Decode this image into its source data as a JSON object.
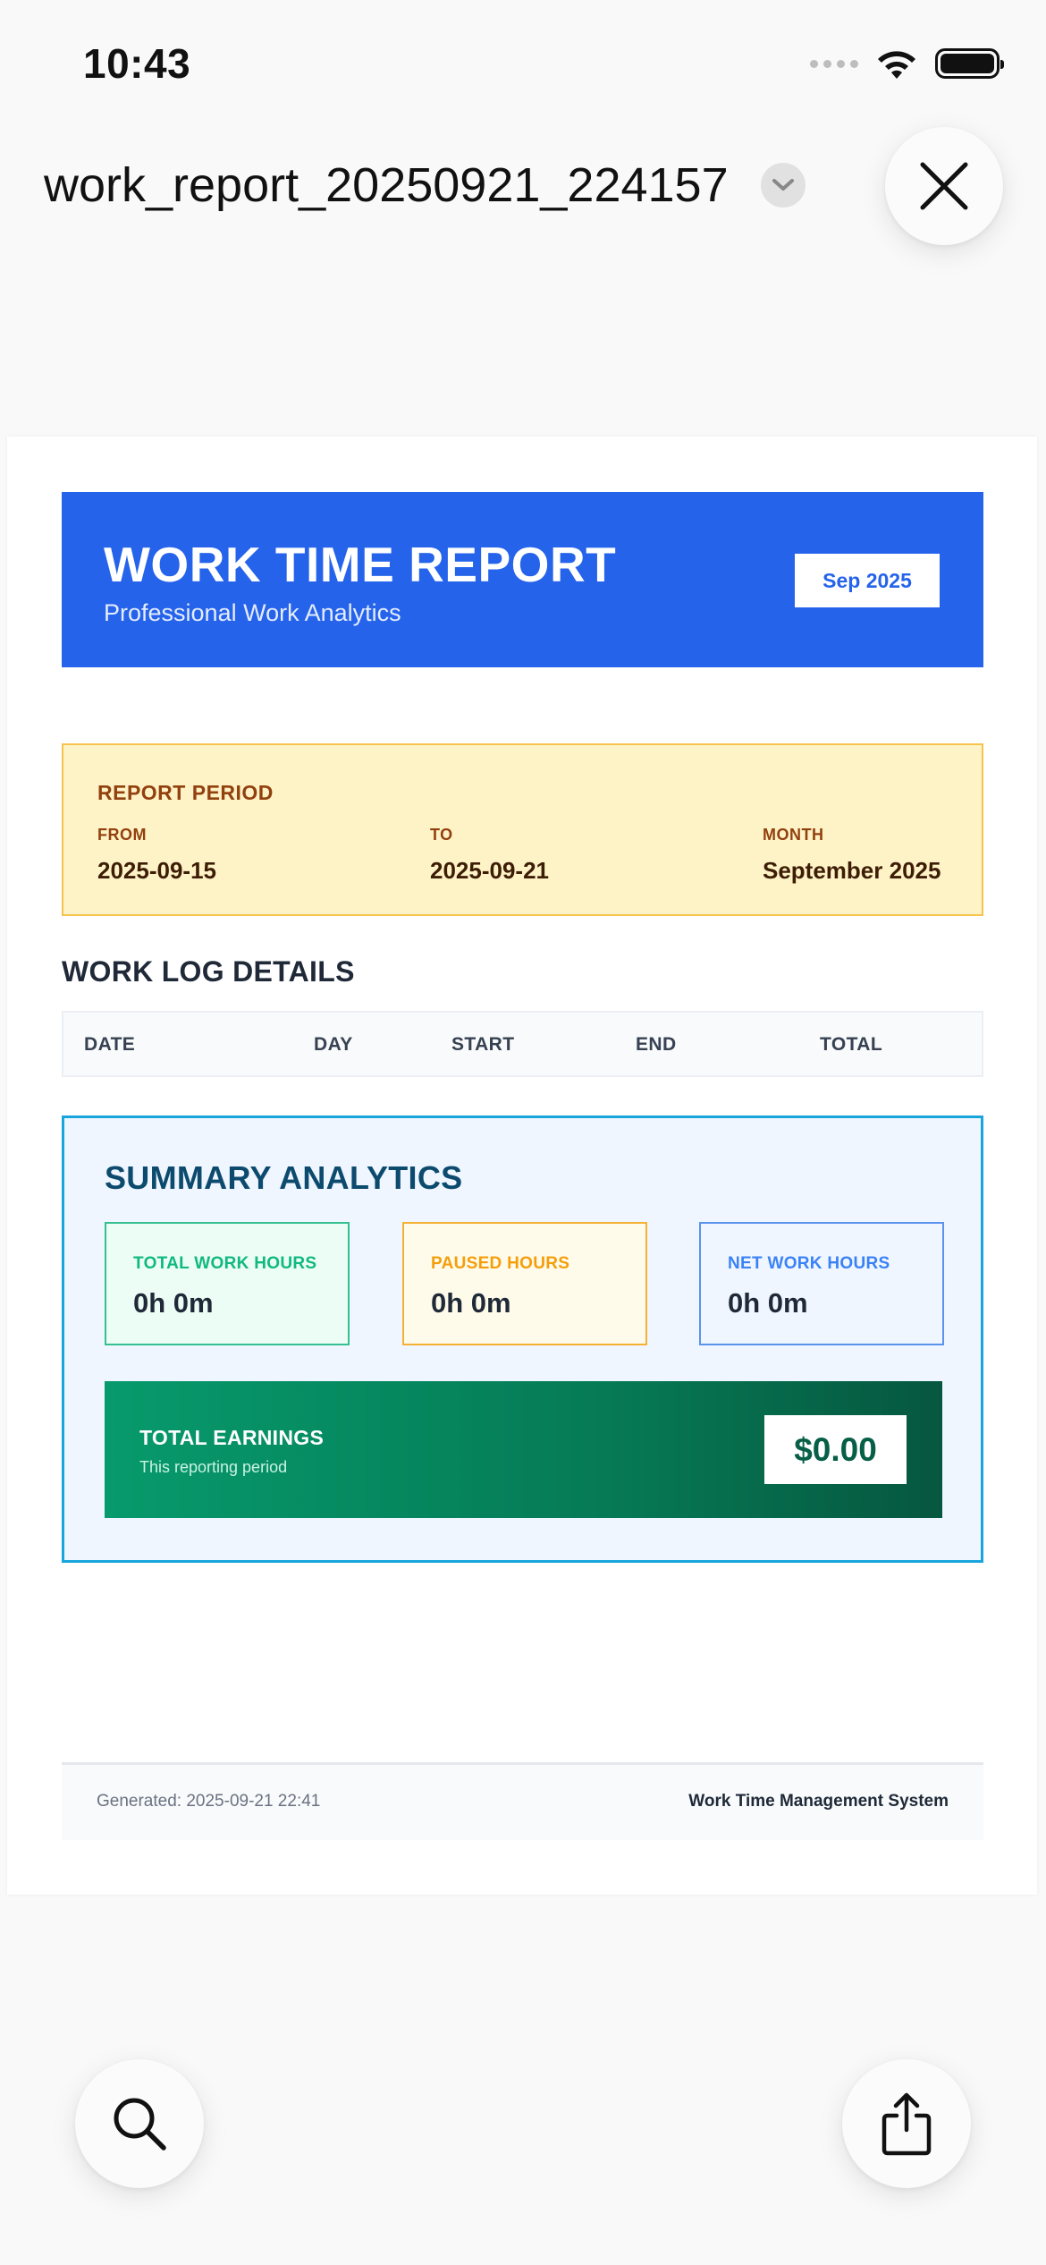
{
  "status_bar": {
    "time": "10:43",
    "icons": [
      "signal-dots-icon",
      "wifi-icon",
      "battery-icon"
    ]
  },
  "viewer": {
    "file_name": "work_report_20250921_224157",
    "title_menu_icon": "chevron-down-icon",
    "close_icon": "close-icon",
    "search_icon": "search-icon",
    "share_icon": "share-icon"
  },
  "report": {
    "title": "WORK TIME REPORT",
    "subtitle": "Professional Work Analytics",
    "month_badge": "Sep 2025",
    "period": {
      "heading": "REPORT PERIOD",
      "from_label": "FROM",
      "from_value": "2025-09-15",
      "to_label": "TO",
      "to_value": "2025-09-21",
      "month_label": "MONTH",
      "month_value": "September 2025"
    },
    "work_log": {
      "title": "WORK LOG DETAILS",
      "columns": [
        "DATE",
        "DAY",
        "START",
        "END",
        "TOTAL"
      ],
      "rows": []
    },
    "summary": {
      "title": "SUMMARY ANALYTICS",
      "cards": [
        {
          "label": "TOTAL WORK HOURS",
          "value": "0h 0m"
        },
        {
          "label": "PAUSED HOURS",
          "value": "0h 0m"
        },
        {
          "label": "NET WORK HOURS",
          "value": "0h 0m"
        }
      ],
      "earnings": {
        "title": "TOTAL EARNINGS",
        "subtitle": "This reporting period",
        "amount": "$0.00"
      }
    },
    "footer": {
      "generated": "Generated: 2025-09-21 22:41",
      "system": "Work Time Management System"
    }
  },
  "colors": {
    "banner_blue": "#2563eb",
    "period_bg": "#fef3c7",
    "period_text": "#92400e",
    "summary_border": "#17a5dc",
    "summary_title": "#0c4a6e",
    "total_green": "#10b981",
    "paused_amber": "#f59e0b",
    "net_blue": "#3b82f6",
    "earnings_green": "#067a55"
  }
}
